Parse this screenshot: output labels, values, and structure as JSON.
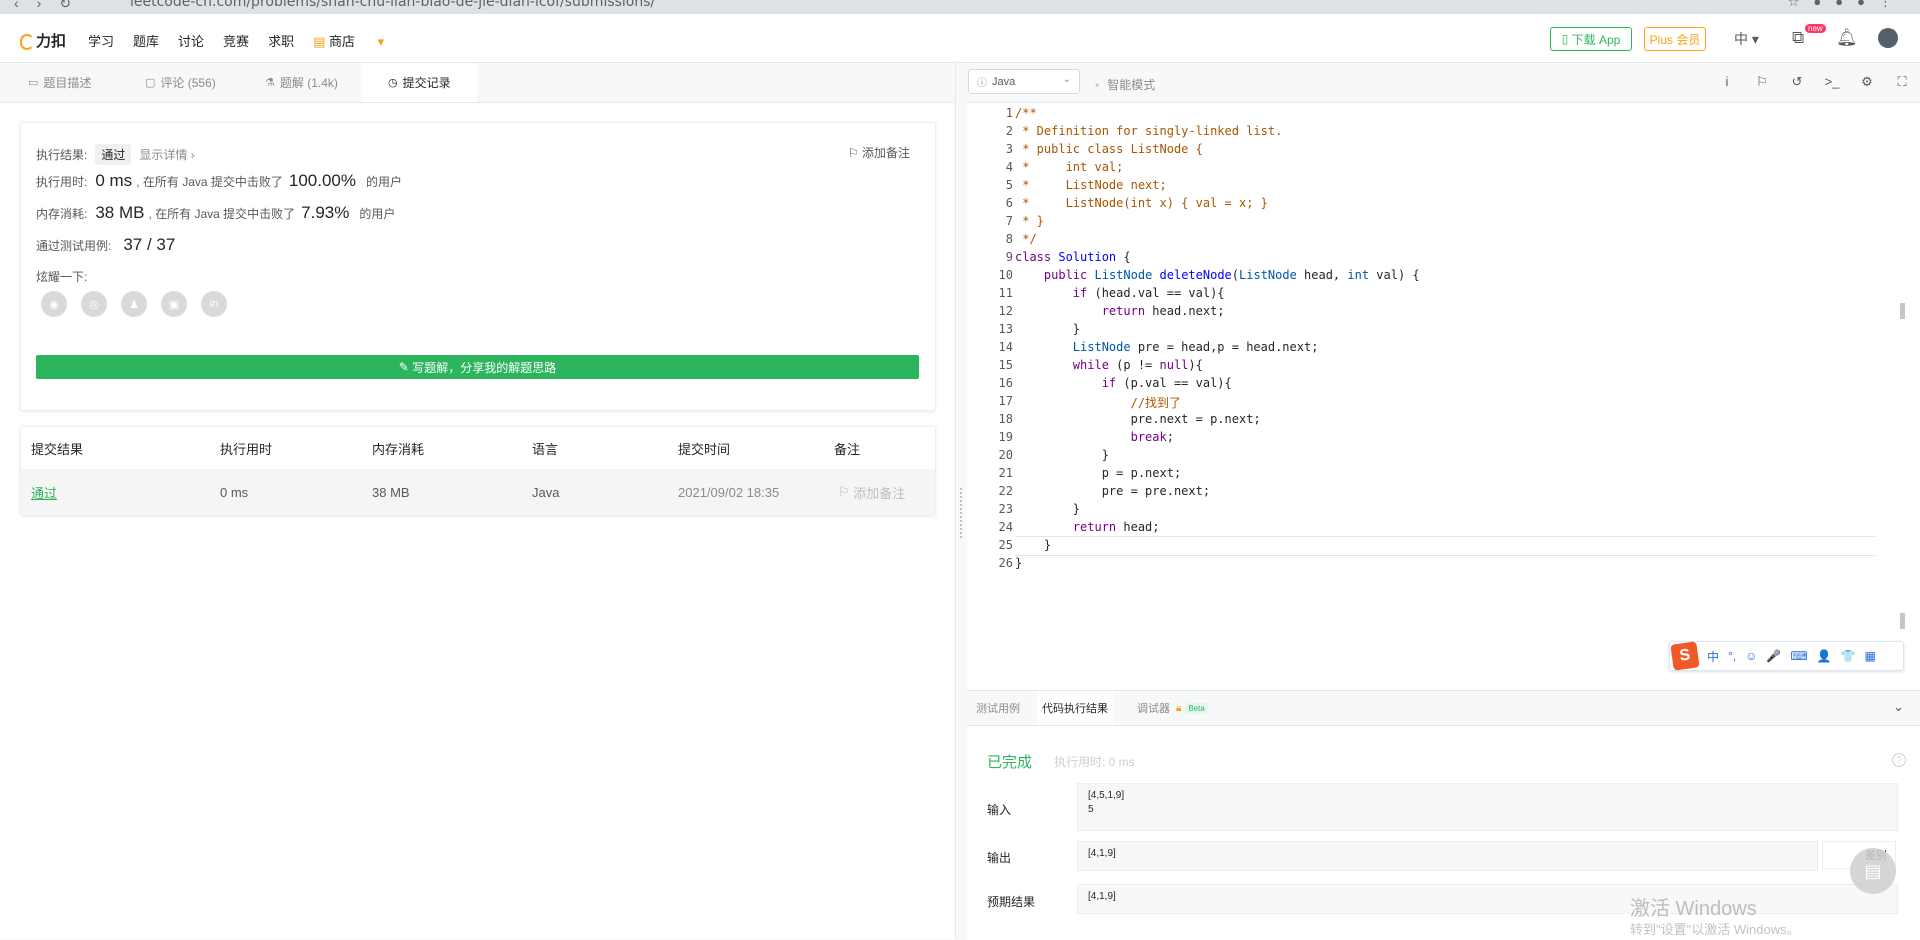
{
  "browser": {
    "url": "leetcode-cn.com/problems/shan-chu-lian-biao-de-jie-dian-lcof/submissions/"
  },
  "topnav": {
    "logo": "力扣",
    "links": [
      "学习",
      "题库",
      "讨论",
      "竞赛",
      "求职",
      "商店"
    ],
    "download_app": "下载 App",
    "plus": "Plus 会员",
    "lang": "中",
    "new_badge": "new"
  },
  "tabs": [
    {
      "label": "题目描述",
      "icon": "file-text-icon"
    },
    {
      "label": "评论 (556)",
      "icon": "comment-icon"
    },
    {
      "label": "题解 (1.4k)",
      "icon": "flask-icon"
    },
    {
      "label": "提交记录",
      "icon": "clock-icon"
    }
  ],
  "result": {
    "status_label": "执行结果:",
    "status": "通过",
    "show_detail": "显示详情 ›",
    "add_note": "添加备注",
    "time_label": "执行用时:",
    "time_value": "0 ms",
    "time_mid": ", 在所有 Java 提交中击败了",
    "time_pct": "100.00%",
    "mem_label": "内存消耗:",
    "mem_value": "38 MB",
    "mem_mid": ", 在所有 Java 提交中击败了",
    "mem_pct": "7.93%",
    "users_suffix": "的用户",
    "tests_label": "通过测试用例:",
    "tests_value": "37 / 37",
    "share_label": "炫耀一下:",
    "write_solution": "写题解，分享我的解题思路"
  },
  "submissions": {
    "headers": [
      "提交结果",
      "执行用时",
      "内存消耗",
      "语言",
      "提交时间",
      "备注"
    ],
    "rows": [
      {
        "result": "通过",
        "time": "0 ms",
        "memory": "38 MB",
        "lang": "Java",
        "submitted": "2021/09/02 18:35",
        "note": "添加备注"
      }
    ]
  },
  "editor": {
    "language": "Java",
    "smart_mode": "智能模式",
    "lines": [
      "/**",
      " * Definition for singly-linked list.",
      " * public class ListNode {",
      " *     int val;",
      " *     ListNode next;",
      " *     ListNode(int x) { val = x; }",
      " * }",
      " */",
      "class Solution {",
      "    public ListNode deleteNode(ListNode head, int val) {",
      "        if (head.val == val){",
      "            return head.next;",
      "        }",
      "        ListNode pre = head,p = head.next;",
      "        while (p != null){",
      "            if (p.val == val){",
      "                //找到了",
      "                pre.next = p.next;",
      "                break;",
      "            }",
      "            p = p.next;",
      "            pre = pre.next;",
      "        }",
      "        return head;",
      "    }",
      "}"
    ],
    "current_line": 25
  },
  "ime": {
    "items": [
      "中",
      "°,",
      "☺",
      "🎤",
      "⌨",
      "👤",
      "👕",
      "▦"
    ]
  },
  "console": {
    "tabs": [
      "测试用例",
      "代码执行结果",
      "调试器"
    ],
    "beta": "Beta",
    "status": "已完成",
    "exec_time": "执行用时: 0 ms",
    "input_label": "输入",
    "input_value": "[4,5,1,9]\n5",
    "output_label": "输出",
    "output_value": "[4,1,9]",
    "diff_label": "差别",
    "expected_label": "预期结果",
    "expected_value": "[4,1,9]"
  },
  "watermark": {
    "line1": "激活 Windows",
    "line2": "转到\"设置\"以激活 Windows。"
  },
  "colors": {
    "green": "#2db55d",
    "orange": "#ffa116"
  }
}
